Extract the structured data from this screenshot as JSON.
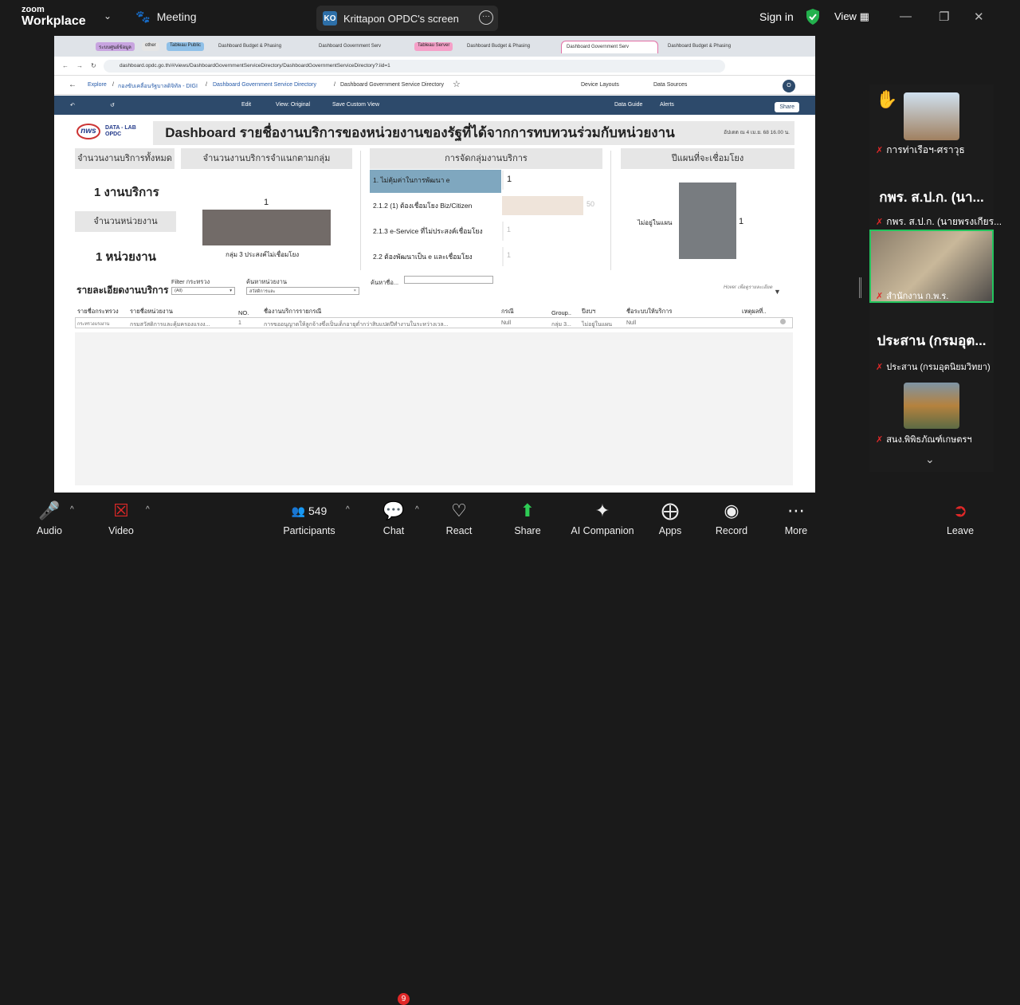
{
  "zoom": {
    "brand_small": "zoom",
    "brand_big": "Workplace",
    "meeting_label": "Meeting",
    "share_badge": "KO",
    "share_title": "Krittapon OPDC's screen",
    "signin": "Sign in",
    "view": "View",
    "controls": {
      "audio": "Audio",
      "video": "Video",
      "participants": "Participants",
      "participants_count": "549",
      "chat": "Chat",
      "chat_badge": "9",
      "react": "React",
      "share": "Share",
      "ai": "AI Companion",
      "apps": "Apps",
      "record": "Record",
      "more": "More",
      "leave": "Leave"
    },
    "participants": [
      {
        "name": "การท่าเรือฯ-ศราวุธ"
      },
      {
        "big": "กพร. ส.ป.ก. (นา...",
        "name": "กพร. ส.ป.ก. (นายพรงเกียร..."
      },
      {
        "name": "สำนักงาน ก.พ.ร."
      },
      {
        "big": "ประสาน (กรมอุต...",
        "name": "ประสาน (กรมอุตนิยมวิทยา)"
      },
      {
        "name": "สนง.พิพิธภัณฑ์เกษตรฯ"
      }
    ]
  },
  "browser": {
    "tab_groups": [
      "ระบบศูนย์ข้อมูล",
      "other",
      "Tableau Public",
      "Tableau Server"
    ],
    "tabs": [
      "Dashboard Budget & Phasing",
      "Dashboard Government Serv",
      "Dashboard Budget & Phasing",
      "Dashboard Government Serv",
      "Dashboard Budget & Phasing"
    ],
    "url": "dashboard.opdc.go.th/#/views/DashboardGovernmentServiceDirectory/DashboardGovernmentServiceDirectory?:iid=1"
  },
  "tableau": {
    "breadcrumb": [
      "Explore",
      "กองขับเคลื่อนรัฐบาลดิจิทัล - DIGI",
      "Dashboard Government Service Directory",
      "Dashboard Government Service Directory"
    ],
    "header_actions": [
      "Device Layouts",
      "Data Sources"
    ],
    "user_initial": "O",
    "toolbar": [
      "Edit",
      "View: Original",
      "Save Custom View",
      "Data Guide",
      "Alerts",
      "Share"
    ]
  },
  "dashboard": {
    "logo_nws": "nws",
    "logo_dl_1": "DATA - LAB",
    "logo_dl_2": "OPDC",
    "title": "Dashboard รายชื่องานบริการของหน่วยงานของรัฐที่ได้จากการทบทวนร่วมกับหน่วยงาน",
    "updated": "อัปเดต ณ 4 เม.ย. 68 16.00 น.",
    "total_services_head": "จำนวนงานบริการทั้งหมด",
    "total_services_value": "1 งานบริการ",
    "total_agencies_head": "จำนวนหน่วยงาน",
    "total_agencies_value": "1 หน่วยงาน",
    "by_group_head": "จำนวนงานบริการจำแนกตามกลุ่ม",
    "group_chart": {
      "type": "bar",
      "categories": [
        "กลุ่ม 3 ประสงค์ไม่เชื่อมโยง"
      ],
      "values": [
        1
      ]
    },
    "classify_head": "การจัดกลุ่มงานบริการ",
    "classify_chart": {
      "type": "bar",
      "categories": [
        "1. ไม่คุ้มค่าในการพัฒนา e",
        "2.1.2 (1) ต้องเชื่อมโยง Biz/Citizen",
        "2.1.3 e-Service ที่ไม่ประสงค์เชื่อมโยง",
        "2.2 ต้องพัฒนาเป็น e และเชื่อมโยง"
      ],
      "values": [
        1,
        50,
        1,
        1
      ]
    },
    "plan_head": "ปีแผนที่จะเชื่อมโยง",
    "plan_chart": {
      "type": "bar",
      "categories": [
        "ไม่อยู่ในแผน"
      ],
      "values": [
        1
      ]
    },
    "details_title": "รายละเอียดงานบริการ",
    "filter_ministry_label": "Filter กระทรวง",
    "filter_ministry_value": "(All)",
    "filter_agency_label": "ค้นหาหน่วยงาน",
    "filter_agency_value": "สวัสดิการและ",
    "search_name_label": "ค้นหาชื่อ...",
    "hover_hint": "Hover เพื่อดูรายละเอียด",
    "columns": [
      "รายชื่อกระทรวง",
      "รายชื่อหน่วยงาน",
      "NO.",
      "ชื่องานบริการรายกรณี",
      "กรณี",
      "Group..",
      "ปีงบฯ",
      "ชื่อระบบให้บริการ",
      "เหตุผลที่.."
    ],
    "row": [
      "กระทรวงแรงงาน",
      "กรมสวัสดิการและคุ้มครองแรงง...",
      "1",
      "การขออนุญาตให้ลูกจ้างซึ่งเป็นเด็กอายุต่ำกว่าสิบแปดปีทำงานในระหว่างเวล...",
      "Null",
      "กลุ่ม 3...",
      "ไม่อยู่ในแผน",
      "Null"
    ]
  },
  "chart_data": [
    {
      "type": "bar",
      "categories": [
        "กลุ่ม 3 ประสงค์ไม่เชื่อมโยง"
      ],
      "values": [
        1
      ],
      "title": "จำนวนงานบริการจำแนกตามกลุ่ม"
    },
    {
      "type": "bar",
      "categories": [
        "1. ไม่คุ้มค่าในการพัฒนา e",
        "2.1.2 (1) ต้องเชื่อมโยง Biz/Citizen",
        "2.1.3 e-Service ที่ไม่ประสงค์เชื่อมโยง",
        "2.2 ต้องพัฒนาเป็น e และเชื่อมโยง"
      ],
      "values": [
        1,
        50,
        1,
        1
      ],
      "title": "การจัดกลุ่มงานบริการ"
    },
    {
      "type": "bar",
      "categories": [
        "ไม่อยู่ในแผน"
      ],
      "values": [
        1
      ],
      "title": "ปีแผนที่จะเชื่อมโยง"
    }
  ]
}
